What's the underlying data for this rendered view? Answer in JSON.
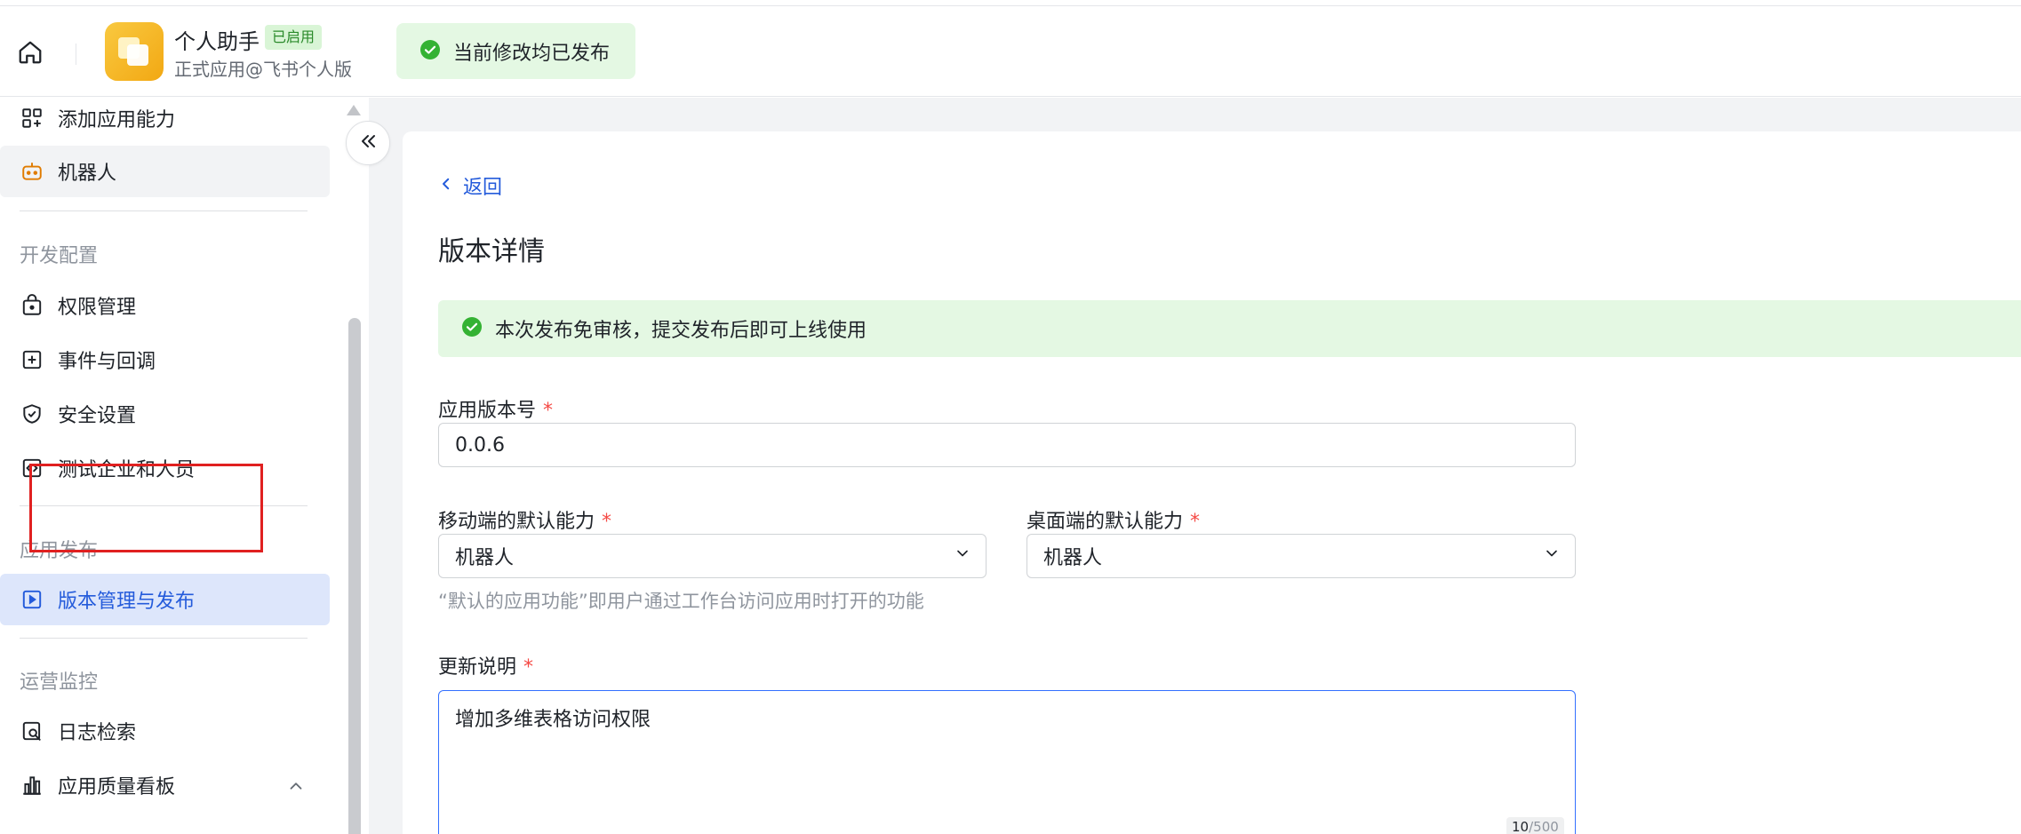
{
  "header": {
    "app_name": "个人助手",
    "app_status": "已启用",
    "app_subtitle": "正式应用@飞书个人版",
    "publish_status": "当前修改均已发布"
  },
  "sidebar": {
    "items_top": [
      {
        "label": "添加应用能力",
        "icon": "grid-add-icon"
      },
      {
        "label": "机器人",
        "icon": "robot-icon"
      }
    ],
    "groups": [
      {
        "title": "开发配置",
        "items": [
          {
            "label": "权限管理",
            "icon": "lock-icon"
          },
          {
            "label": "事件与回调",
            "icon": "event-add-icon"
          },
          {
            "label": "安全设置",
            "icon": "shield-icon"
          },
          {
            "label": "测试企业和人员",
            "icon": "code-icon"
          }
        ]
      },
      {
        "title": "应用发布",
        "items": [
          {
            "label": "版本管理与发布",
            "icon": "version-icon",
            "active": true
          }
        ]
      },
      {
        "title": "运营监控",
        "items": [
          {
            "label": "日志检索",
            "icon": "log-search-icon"
          },
          {
            "label": "应用质量看板",
            "icon": "bar-chart-icon"
          }
        ]
      }
    ]
  },
  "main": {
    "back_label": "返回",
    "title": "版本详情",
    "notice": "本次发布免审核，提交发布后即可上线使用",
    "version": {
      "label": "应用版本号",
      "required_mark": "*",
      "value": "0.0.6"
    },
    "mobile_default": {
      "label": "移动端的默认能力",
      "required_mark": "*",
      "value": "机器人"
    },
    "desktop_default": {
      "label": "桌面端的默认能力",
      "required_mark": "*",
      "value": "机器人"
    },
    "default_hint": "“默认的应用功能”即用户通过工作台访问应用时打开的功能",
    "update_notes": {
      "label": "更新说明",
      "required_mark": "*",
      "value": "增加多维表格访问权限",
      "count": "10",
      "max": "/500"
    }
  },
  "colors": {
    "accent": "#245bdb",
    "success": "#34b233",
    "success_bg": "#e4f8e3",
    "active_bg": "#dde6fb",
    "required": "#f54a45",
    "highlight_box": "#e02020"
  }
}
